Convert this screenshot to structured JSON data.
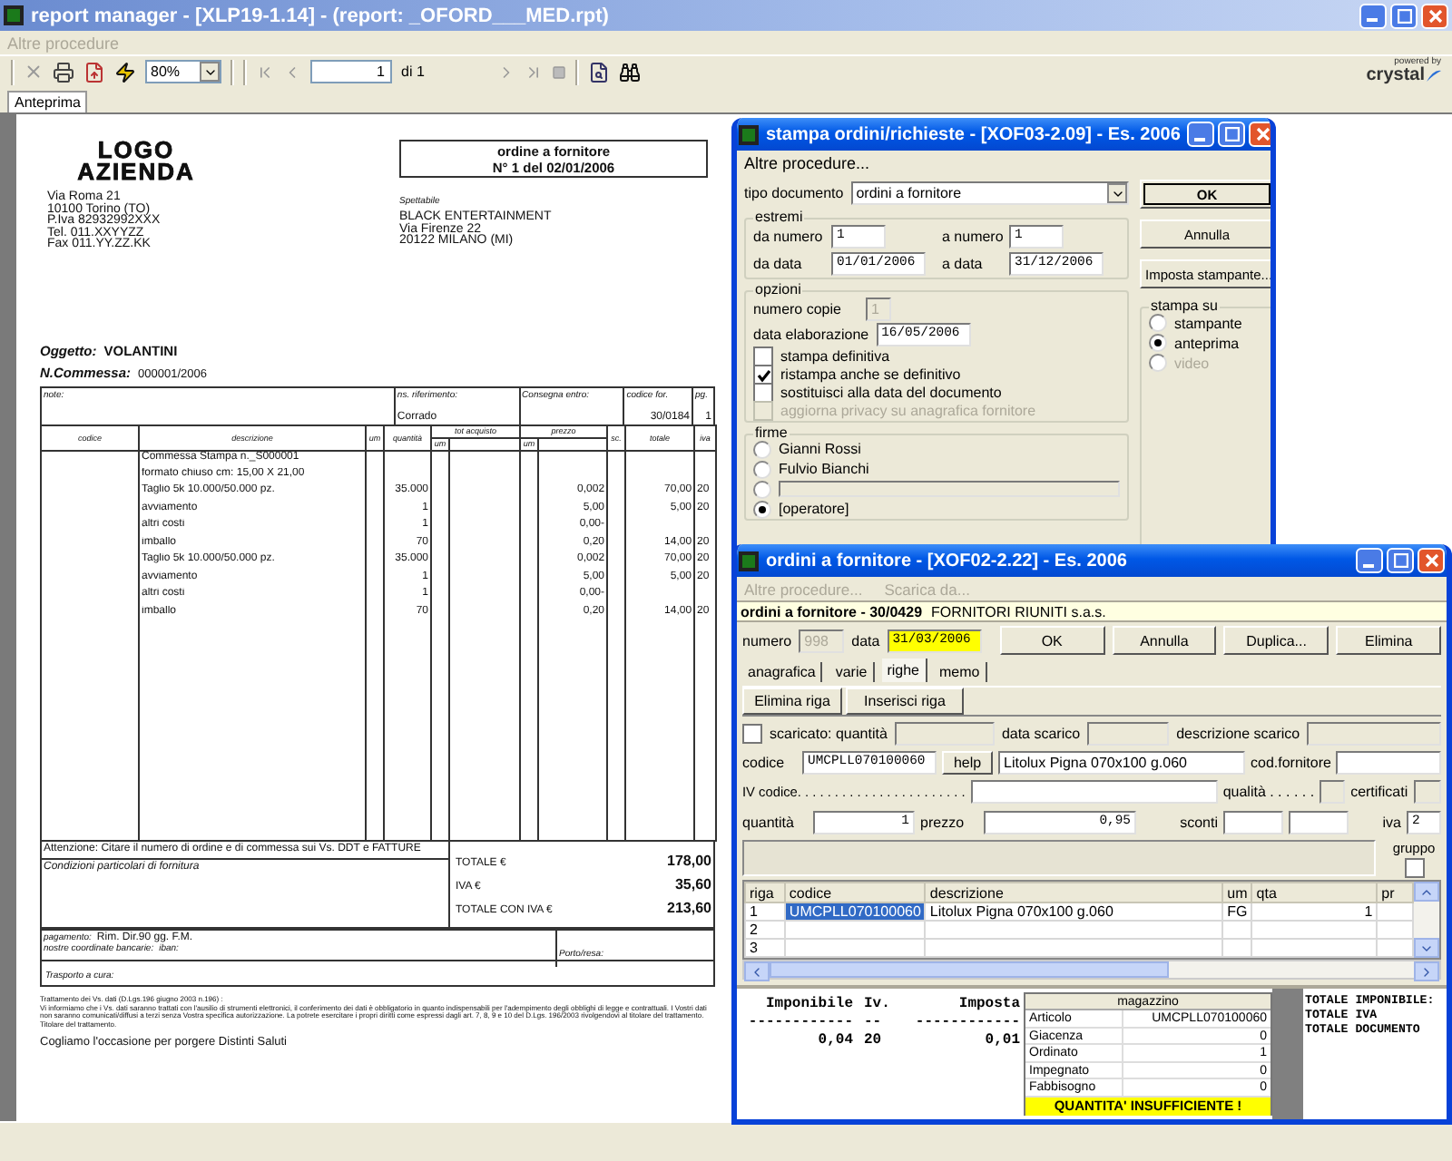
{
  "window": {
    "title": "report manager - [XLP19-1.14] - (report: _OFORD___MED.rpt)",
    "menu": [
      "Altre procedure"
    ]
  },
  "toolbar": {
    "zoom": "80%",
    "page": "1",
    "page_of": "di 1",
    "brand_top": "powered by",
    "brand": "crystal"
  },
  "tabs": [
    {
      "label": "Anteprima",
      "selected": true
    }
  ],
  "report": {
    "logo": [
      "LOGO",
      "AZIENDA"
    ],
    "company_lines": [
      "Via Roma 21",
      "10100 Torino (TO)",
      "P.Iva 82932992XXX",
      "Tel. 011.XXYYZZ",
      "Fax 011.YY.ZZ.KK"
    ],
    "doc_title": "ordine a fornitore",
    "doc_number": "N° 1 del 02/01/2006",
    "recipient_label": "Spettabile",
    "recipient_lines": [
      "BLACK ENTERTAINMENT",
      "Via Firenze 22",
      "20122 MILANO (MI)"
    ],
    "subject_label": "Oggetto:",
    "subject": "VOLANTINI",
    "job_label": "N.Commessa:",
    "job": "000001/2006",
    "info": [
      {
        "label": "note:"
      },
      {
        "label": "ns. riferimento:",
        "value": "Corrado"
      },
      {
        "label": "Consegna entro:"
      },
      {
        "label": "codice for.",
        "value": "30/0184"
      },
      {
        "label": "pg.",
        "value": "1"
      }
    ],
    "columns": [
      {
        "label": "codice"
      },
      {
        "label": "descrizione"
      },
      {
        "label": "um"
      },
      {
        "label": "quantità"
      },
      {
        "label": "tot acquisto",
        "sub": "um"
      },
      {
        "label": "prezzo",
        "sub": "um"
      },
      {
        "label": "sc."
      },
      {
        "label": "totale"
      },
      {
        "label": "iva"
      }
    ],
    "rows": [
      {
        "description": "Commessa Stampa n._S000001"
      },
      {
        "description": "formato chiuso cm: 15,00 X 21,00"
      },
      {
        "description": "Taglio 5k 10.000/50.000 pz.",
        "quantity": "35.000",
        "price": "0,002",
        "total": "70,00",
        "vat": "20"
      },
      {
        "description": "avviamento",
        "quantity": "1",
        "price": "5,00",
        "total": "5,00",
        "vat": "20"
      },
      {
        "description": "altri costi",
        "quantity": "1",
        "price": "0,00-"
      },
      {
        "description": "imballo",
        "quantity": "70",
        "price": "0,20",
        "total": "14,00",
        "vat": "20"
      },
      {
        "description": "Taglio 5k 10.000/50.000 pz.",
        "quantity": "35.000",
        "price": "0,002",
        "total": "70,00",
        "vat": "20"
      },
      {
        "description": "avviamento",
        "quantity": "1",
        "price": "5,00",
        "total": "5,00",
        "vat": "20"
      },
      {
        "description": "altri costi",
        "quantity": "1",
        "price": "0,00-"
      },
      {
        "description": "imballo",
        "quantity": "70",
        "price": "0,20",
        "total": "14,00",
        "vat": "20"
      }
    ],
    "notice": "Attenzione: Citare il numero di ordine e di commessa sui Vs. DDT e FATTURE",
    "conditions": "Condizioni particolari di fornitura",
    "totals": [
      {
        "label": "TOTALE €",
        "value": "178,00"
      },
      {
        "label": "IVA €",
        "value": "35,60"
      },
      {
        "label": "TOTALE CON IVA €",
        "value": "213,60"
      }
    ],
    "payment_label": "pagamento:",
    "payment": "Rim. Dir.90 gg. F.M.",
    "bank_label": "nostre coordinate bancarie:",
    "iban_label": "iban:",
    "port_label": "Porto/resa:",
    "transport_label": "Trasporto a cura:",
    "privacy_title": "Trattamento dei Vs. dati (D.Lgs.196 giugno 2003 n.196) :",
    "privacy_text": "Vi informiamo che i Vs. dati saranno trattati con l'ausilio di strumenti elettronici, il conferimento dei dati è obbligatorio in quanto indispensabili per l'adempimento degli obblighi di legge e contrattuali. I Vostri dati non saranno comunicati/diffusi a terzi senza Vostra specifica autorizzazione. La potrete esercitare i propri diritti come espressi dagli art. 7, 8, 9 e 10 del D.Lgs. 196/2003 rivolgendovi al titolare del trattamento. Titolare del trattamento.",
    "closing": "Cogliamo l'occasione per porgere Distinti Saluti"
  },
  "print_dialog": {
    "title": "stampa ordini/richieste - [XOF03-2.09] - Es. 2006",
    "menu": [
      "Altre procedure..."
    ],
    "doc_type_label": "tipo documento",
    "doc_type": "ordini a fornitore",
    "buttons": [
      {
        "label": "OK",
        "default": true
      },
      {
        "label": "Annulla",
        "default": false
      },
      {
        "label": "Imposta stampante...",
        "default": false
      }
    ],
    "range_title": "estremi",
    "range_fields": [
      {
        "label": "da numero",
        "value": "1",
        "kind": "number"
      },
      {
        "label": "a numero",
        "value": "1",
        "kind": "number"
      },
      {
        "label": "da data",
        "value": "01/01/2006",
        "kind": "date"
      },
      {
        "label": "a data",
        "value": "31/12/2006",
        "kind": "date"
      }
    ],
    "options_title": "opzioni",
    "copies_label": "numero copie",
    "copies": "1",
    "copies_disabled": true,
    "date_label": "data elaborazione",
    "date": "16/05/2006",
    "checks": [
      {
        "label": "stampa definitiva",
        "checked": false,
        "disabled": false
      },
      {
        "label": "ristampa anche se definitivo",
        "checked": true,
        "disabled": false
      },
      {
        "label": "sostituisci alla data del documento",
        "checked": false,
        "disabled": false
      },
      {
        "label": "aggiorna privacy su anagrafica fornitore",
        "checked": false,
        "disabled": true
      }
    ],
    "signatures_title": "firme",
    "signatures": [
      {
        "kind": "label",
        "label": "Gianni Rossi",
        "selected": false
      },
      {
        "kind": "label",
        "label": "Fulvio Bianchi",
        "selected": false
      },
      {
        "kind": "field",
        "selected": false
      },
      {
        "kind": "label",
        "label": "[operatore]",
        "selected": true
      }
    ],
    "output_title": "stampa su",
    "outputs": [
      {
        "label": "stampante",
        "selected": false,
        "disabled": false
      },
      {
        "label": "anteprima",
        "selected": true,
        "disabled": false
      },
      {
        "label": "video",
        "selected": false,
        "disabled": true
      }
    ]
  },
  "order_dialog": {
    "title": "ordini a fornitore - [XOF02-2.22] - Es. 2006",
    "menu": [
      "Altre procedure...",
      "Scarica da..."
    ],
    "header_bold": "ordini a fornitore - 30/0429",
    "header_text": "FORNITORI RIUNITI s.a.s.",
    "number_label": "numero",
    "number": "998",
    "date_label": "data",
    "date": "31/03/2006",
    "buttons": [
      "OK",
      "Annulla",
      "Duplica...",
      "Elimina"
    ],
    "tabs": [
      {
        "label": "anagrafica",
        "selected": false
      },
      {
        "label": "varie",
        "selected": false
      },
      {
        "label": "righe",
        "selected": true
      },
      {
        "label": "memo",
        "selected": false
      }
    ],
    "row_buttons": [
      "Elimina riga",
      "Inserisci riga"
    ],
    "unloaded": {
      "label": "scaricato: quantità",
      "checked": false
    },
    "unload_date_label": "data scarico",
    "unload_desc_label": "descrizione scarico",
    "code_label": "codice",
    "code": "UMCPLL070100060",
    "help": "help",
    "description": "Litolux Pigna 070x100 g.060",
    "supplier_code_label": "cod.fornitore",
    "iv_label": "IV codice. . . . . . . . . . . . . . . . . . . . . . .",
    "quality_label": "qualità . . . . . .",
    "cert_label": "certificati",
    "qty_label": "quantità",
    "qty": "1",
    "price_label": "prezzo",
    "price": "0,95",
    "discount_label": "sconti",
    "vat_label": "iva",
    "vat": "2",
    "group_label": "gruppo",
    "group_checked": false,
    "grid": {
      "columns": [
        "riga",
        "codice",
        "descrizione",
        "um",
        "qta",
        "pr"
      ],
      "rows": [
        {
          "cells": [
            "1",
            "UMCPLL070100060",
            "Litolux Pigna 070x100 g.060",
            "FG",
            "1"
          ],
          "selected": true
        },
        {
          "cells": [
            "2"
          ],
          "selected": false
        },
        {
          "cells": [
            "3"
          ],
          "selected": false
        }
      ]
    },
    "vat_summary": {
      "columns": [
        "Imponibile",
        "Iv.",
        "Imposta"
      ],
      "dashes": [
        "------------",
        "--",
        "------------"
      ],
      "values": [
        "0,04",
        "20",
        "0,01"
      ]
    },
    "stock": {
      "title": "magazzino",
      "rows": [
        {
          "label": "Articolo",
          "value": "UMCPLL070100060"
        },
        {
          "label": "Giacenza",
          "value": "0"
        },
        {
          "label": "Ordinato",
          "value": "1"
        },
        {
          "label": "Impegnato",
          "value": "0"
        },
        {
          "label": "Fabbisogno",
          "value": "0"
        }
      ],
      "warning": "QUANTITA' INSUFFICIENTE !"
    },
    "totals": [
      "TOTALE IMPONIBILE:",
      "TOTALE IVA",
      "TOTALE DOCUMENTO"
    ]
  }
}
